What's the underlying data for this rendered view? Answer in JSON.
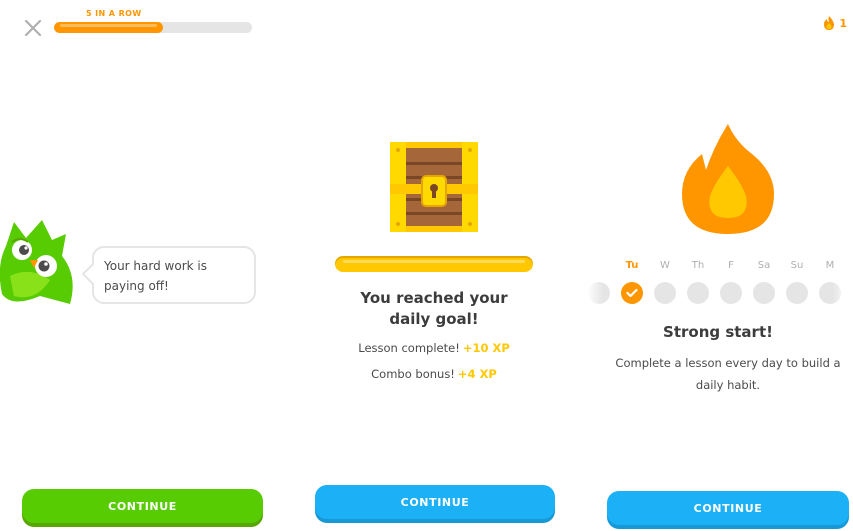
{
  "colors": {
    "orange": "#ff9600",
    "gold": "#ffc800",
    "green": "#58cc02",
    "blue": "#1cb0f6",
    "gray": "#e5e5e5"
  },
  "lesson_screen": {
    "close_icon": "close-icon",
    "streak_label": "5 IN A ROW",
    "progress": 0.55,
    "mascot": "owl-mascot",
    "speech": "Your hard work is paying off!",
    "continue_label": "CONTINUE"
  },
  "goal_screen": {
    "chest_icon": "treasure-chest-icon",
    "goal_progress": 1.0,
    "title": "You reached your daily goal!",
    "rewards": [
      {
        "label": "Lesson complete!",
        "xp": "+10 XP"
      },
      {
        "label": "Combo bonus!",
        "xp": "+4 XP"
      }
    ],
    "continue_label": "CONTINUE"
  },
  "streak_screen": {
    "streak_count": "1",
    "flame_icon": "flame-icon",
    "days": [
      {
        "label": "",
        "active": false
      },
      {
        "label": "Tu",
        "active": true
      },
      {
        "label": "W",
        "active": false
      },
      {
        "label": "Th",
        "active": false
      },
      {
        "label": "F",
        "active": false
      },
      {
        "label": "Sa",
        "active": false
      },
      {
        "label": "Su",
        "active": false
      },
      {
        "label": "M",
        "active": false
      },
      {
        "label": "",
        "active": false
      }
    ],
    "title": "Strong start!",
    "description": "Complete a lesson every day to build a daily habit.",
    "continue_label": "CONTINUE"
  }
}
